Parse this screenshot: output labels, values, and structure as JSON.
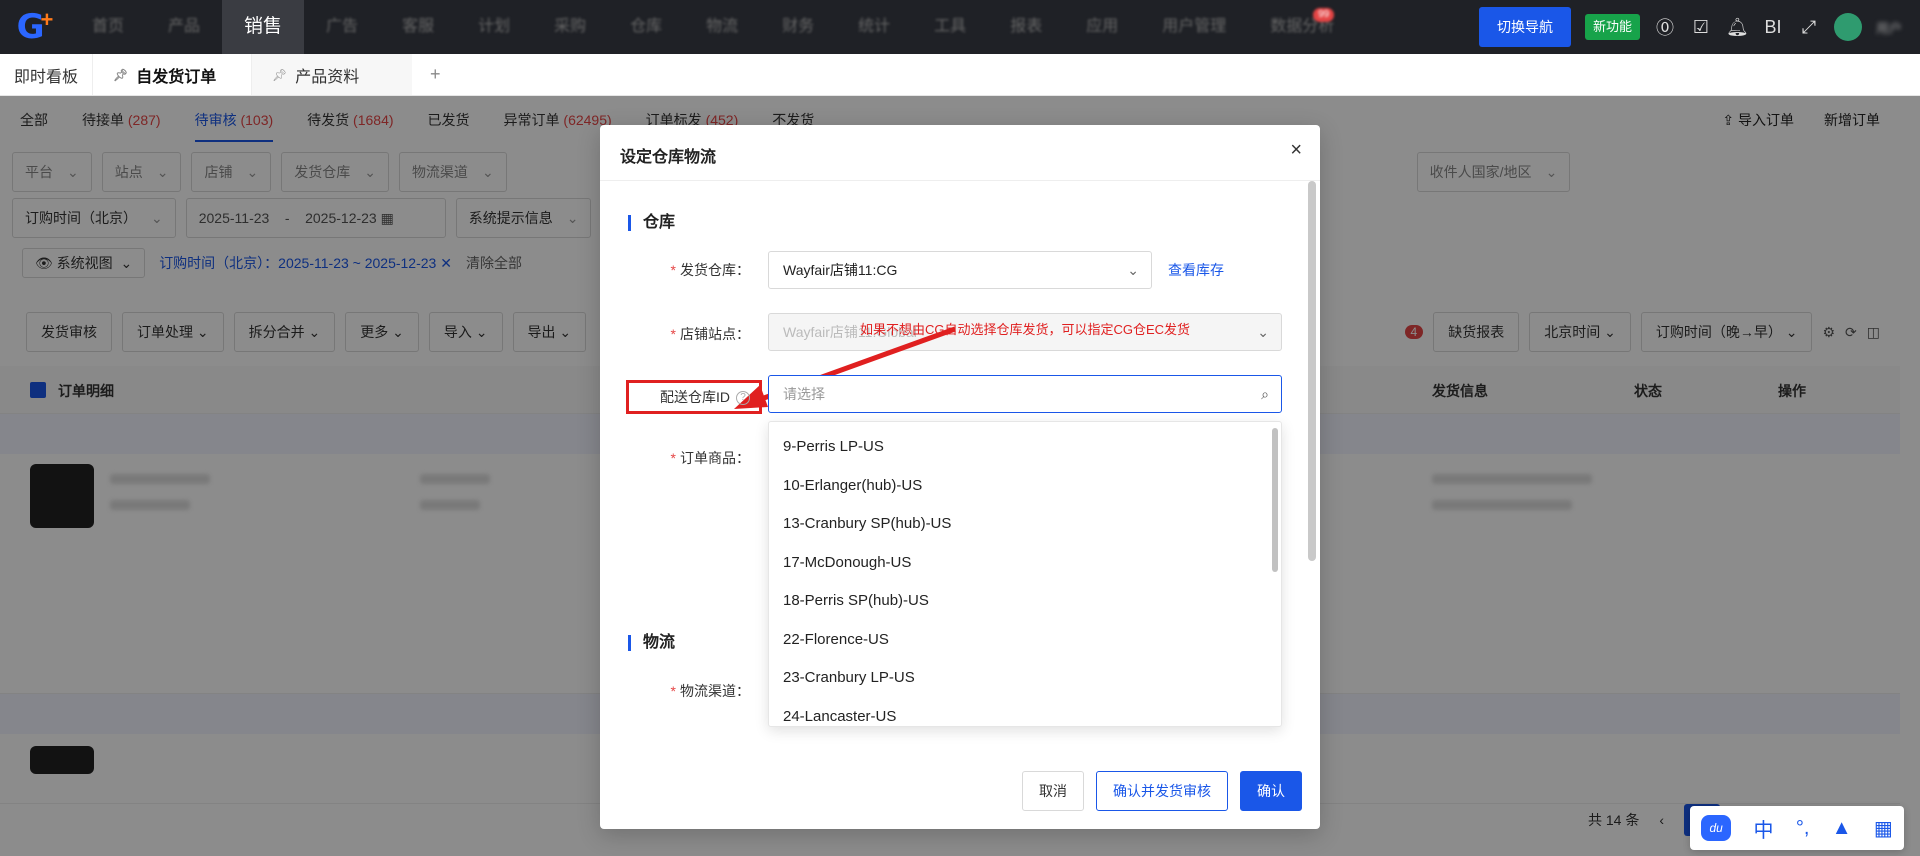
{
  "top_nav": {
    "items": [
      "首页",
      "产品",
      "销售",
      "广告",
      "客服",
      "计划",
      "采购",
      "仓库",
      "物流",
      "财务",
      "统计",
      "工具",
      "报表",
      "应用",
      "用户管理",
      "数据分析"
    ],
    "active_index": 2,
    "badge": "99",
    "switch_nav": "切换导航",
    "new_feature": "新功能",
    "bi": "BI",
    "user": "用户"
  },
  "page_tabs": {
    "dashboard": "即时看板",
    "tab1": "自发货订单",
    "tab2": "产品资料",
    "add": "+"
  },
  "status_tabs": [
    {
      "label": "全部",
      "count": ""
    },
    {
      "label": "待接单",
      "count": "(287)"
    },
    {
      "label": "待审核",
      "count": "(103)"
    },
    {
      "label": "待发货",
      "count": "(1684)"
    },
    {
      "label": "已发货",
      "count": ""
    },
    {
      "label": "异常订单",
      "count": "(62495)"
    },
    {
      "label": "订单标发",
      "count": "(452)"
    },
    {
      "label": "不发货",
      "count": ""
    }
  ],
  "top_actions": {
    "import": "导入订单",
    "new": "新增订单"
  },
  "filters_row1": [
    "平台",
    "站点",
    "店铺",
    "发货仓库",
    "物流渠道",
    "收件人国家/地区"
  ],
  "filters_row2": {
    "time_type": "订购时间（北京）",
    "start": "2025-11-23",
    "dash": "-",
    "end": "2025-12-23",
    "hint": "系统提示信息"
  },
  "view": {
    "name": "系统视图",
    "tag": "订购时间（北京）：2025-11-23 ~ 2025-12-23",
    "clear": "清除全部"
  },
  "toolbar": [
    "发货审核",
    "订单处理",
    "拆分合并",
    "更多",
    "导入",
    "导出"
  ],
  "toolbar_right": {
    "badge": "4",
    "b1": "缺货报表",
    "b2": "北京时间",
    "b3": "订购时间（晚→早）"
  },
  "table_header": {
    "detail": "订单明细",
    "ship": "发货信息",
    "status": "状态",
    "ops": "操作"
  },
  "pager": {
    "total": "共 14 条"
  },
  "modal": {
    "title": "设定仓库物流",
    "close": "×",
    "section_warehouse": "仓库",
    "ship_wh_label": "发货仓库：",
    "ship_wh_value": "Wayfair店铺11:CG",
    "view_stock": "查看库存",
    "shop_site_label": "店铺站点：",
    "shop_site_value": "Wayfair店铺11:Global",
    "delivery_wh_label": "配送仓库ID",
    "delivery_wh_placeholder": "请选择",
    "order_goods_label": "订单商品：",
    "hint": "如果不想由CG自动选择仓库发货，可以指定CG仓EC发货",
    "section_logistics": "物流",
    "logistics_label": "物流渠道：",
    "options": [
      "9-Perris LP-US",
      "10-Erlanger(hub)-US",
      "13-Cranbury SP(hub)-US",
      "17-McDonough-US",
      "18-Perris SP(hub)-US",
      "22-Florence-US",
      "23-Cranbury LP-US",
      "24-Lancaster-US"
    ],
    "cancel": "取消",
    "confirm_review": "确认并发货审核",
    "confirm": "确认"
  },
  "ime": {
    "du": "du",
    "zh": "中",
    "punct": "°,"
  }
}
